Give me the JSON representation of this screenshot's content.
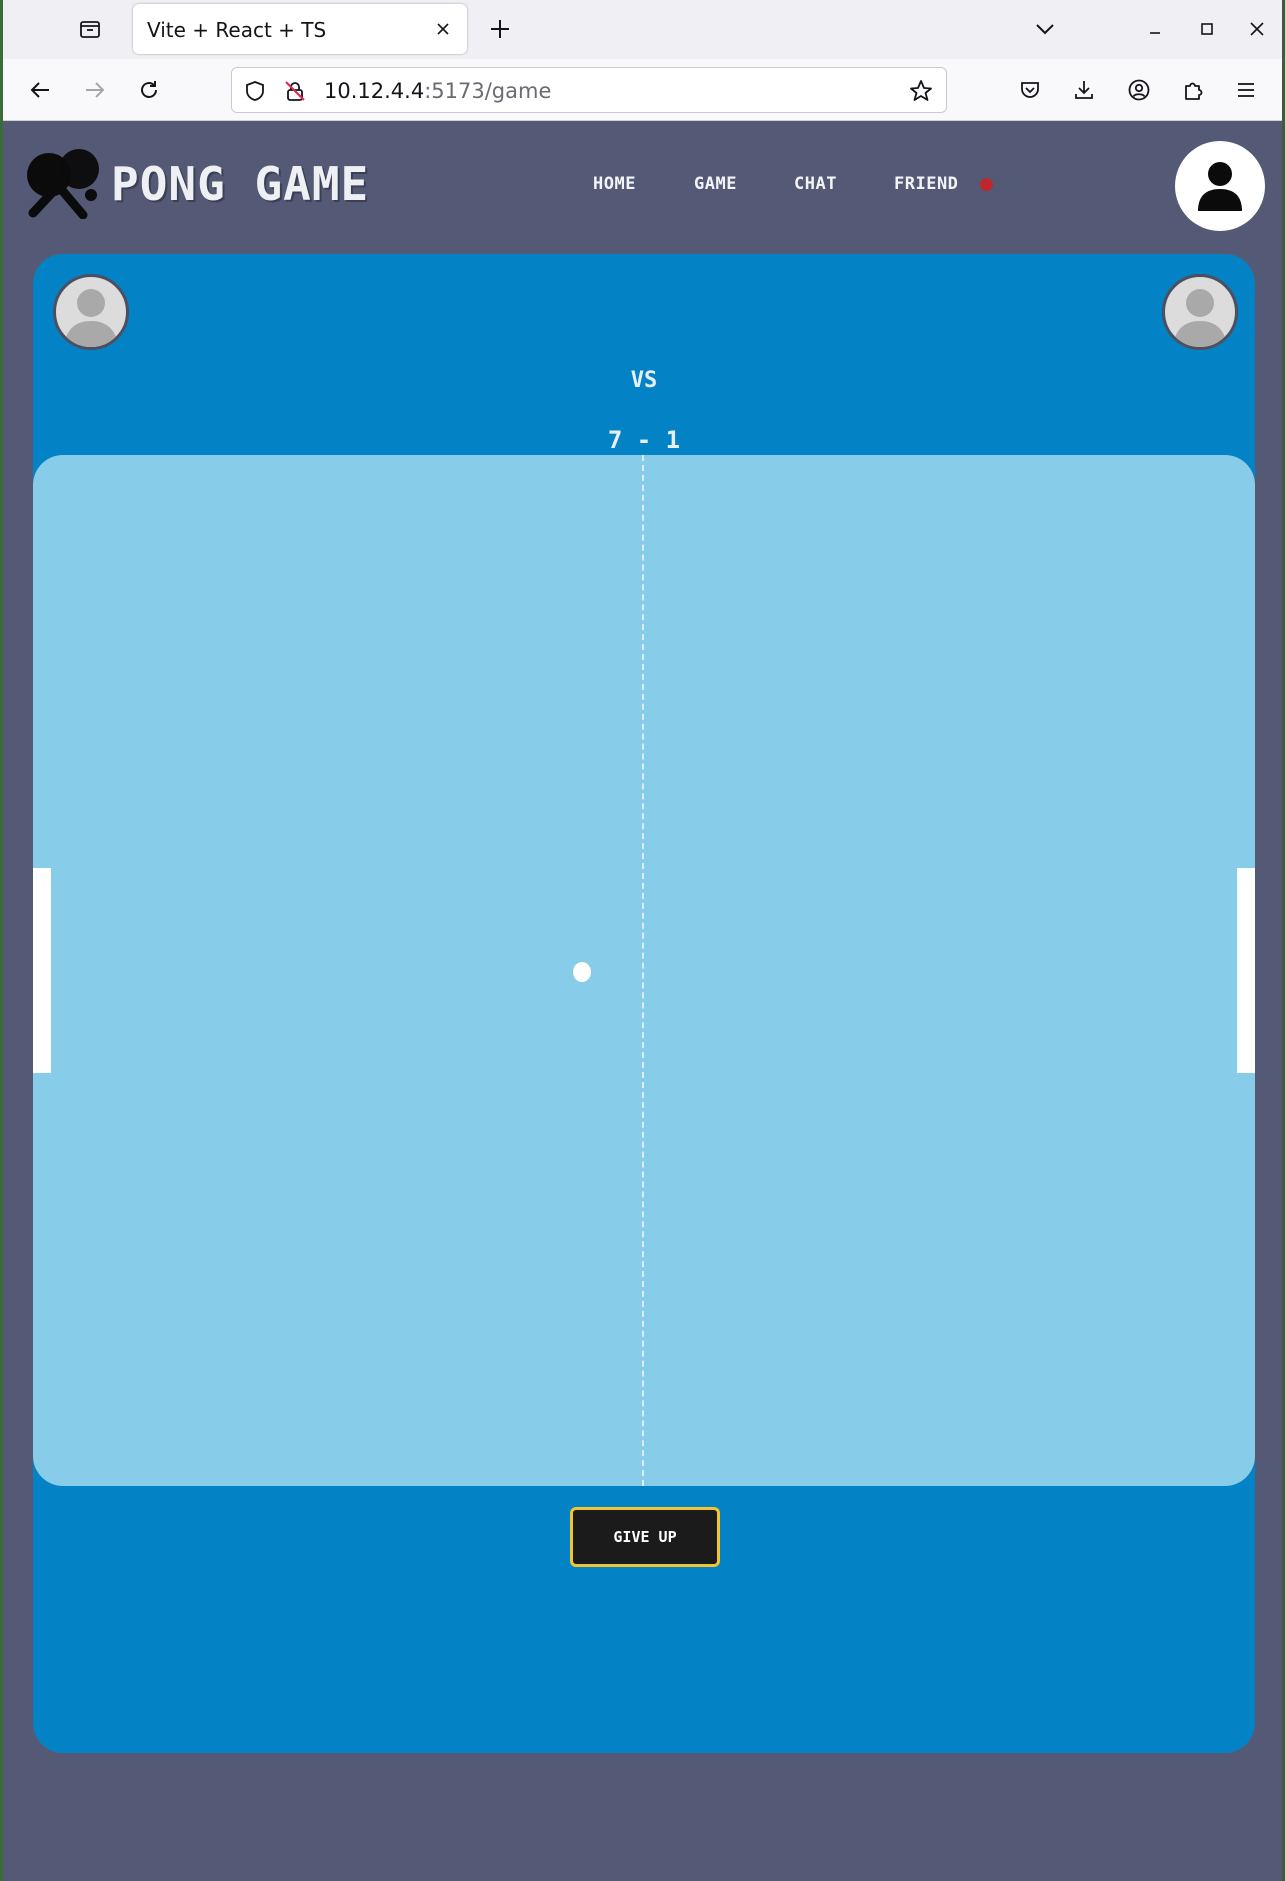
{
  "browser": {
    "tab_title": "Vite + React + TS",
    "url_host": "10.12.4.4",
    "url_path": ":5173/game"
  },
  "app": {
    "title": "PONG GAME",
    "menu": [
      "HOME",
      "GAME",
      "CHAT",
      "FRIEND"
    ],
    "has_friend_notification": true
  },
  "game": {
    "vs_label": "VS",
    "score": "7 - 1",
    "give_up_label": "GIVE UP"
  },
  "colors": {
    "page_background": "#545a75",
    "panel": "#0383c6",
    "field": "#87cce9",
    "notification": "#c0262d",
    "button_border": "#f2c530"
  },
  "icons": {
    "tab_list": "tab-list-icon",
    "close": "close-icon",
    "new_tab": "plus-icon",
    "back": "back-arrow-icon",
    "forward": "forward-arrow-icon",
    "reload": "reload-icon",
    "shield": "shield-icon",
    "insecure": "insecure-lock-icon",
    "bookmark": "star-icon",
    "pocket": "pocket-icon",
    "downloads": "download-icon",
    "account": "account-icon",
    "extensions": "puzzle-icon",
    "menu": "hamburger-menu-icon",
    "logo": "ping-pong-paddle-icon",
    "profile": "user-icon"
  }
}
